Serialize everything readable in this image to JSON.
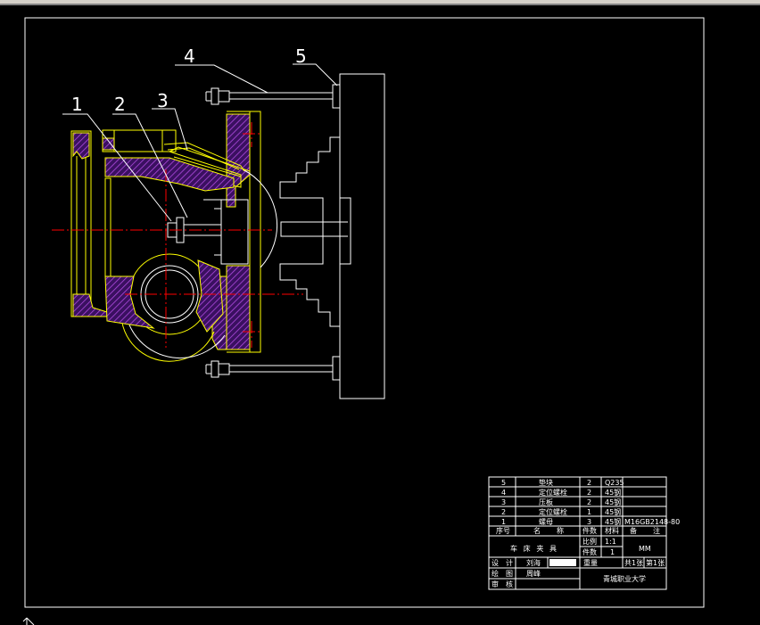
{
  "callouts": [
    "1",
    "2",
    "3",
    "4",
    "5"
  ],
  "parts_list": [
    {
      "no": "5",
      "name": "垫块",
      "qty": "2",
      "material": "Q235",
      "note": ""
    },
    {
      "no": "4",
      "name": "定位螺栓",
      "qty": "2",
      "material": "45钢",
      "note": ""
    },
    {
      "no": "3",
      "name": "压板",
      "qty": "2",
      "material": "45钢",
      "note": ""
    },
    {
      "no": "2",
      "name": "定位螺栓",
      "qty": "1",
      "material": "45钢",
      "note": ""
    },
    {
      "no": "1",
      "name": "螺母",
      "qty": "3",
      "material": "45钢",
      "note": "M16GB2148-80"
    }
  ],
  "header_row": {
    "no": "序号",
    "name": "名称",
    "qty": "件数",
    "material": "材料",
    "note": "备注"
  },
  "title_block": {
    "drawing_name": "车床夹具",
    "scale_label": "比例",
    "scale_value": "1:1",
    "count_label": "件数",
    "count_value": "1",
    "unit": "MM",
    "weight_label": "重量",
    "sheets": "共1张",
    "sheet_no": "第1张",
    "design_label": "设计",
    "designer": "刘海",
    "drawing_label": "绘图",
    "drafter": "周峰",
    "check_label": "审核",
    "school": "青城职业大学"
  },
  "colors": {
    "background": "#000000",
    "outline": "#ffffff",
    "part": "#ffff00",
    "hatch": "#8a2fcf",
    "centerline": "#ff0000"
  }
}
